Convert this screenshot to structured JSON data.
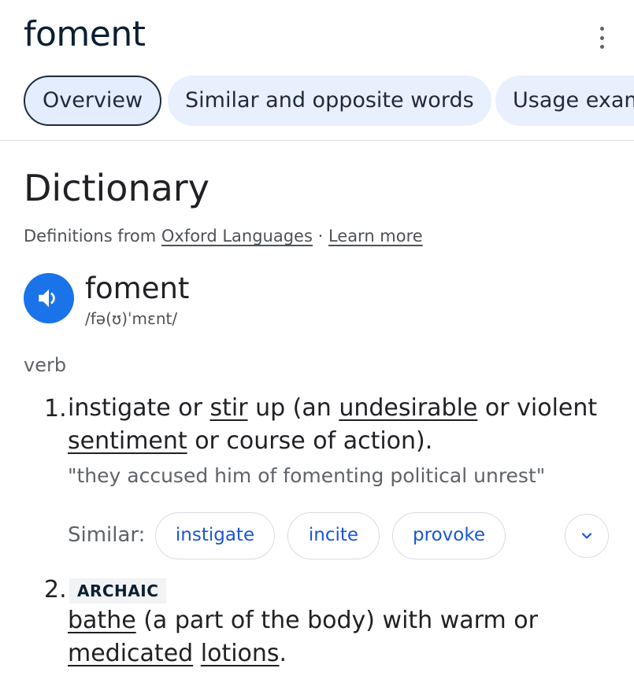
{
  "header": {
    "title": "foment",
    "menu_icon": "more-vert-icon"
  },
  "tabs": [
    {
      "label": "Overview",
      "active": true
    },
    {
      "label": "Similar and opposite words",
      "active": false
    },
    {
      "label": "Usage exam",
      "active": false
    }
  ],
  "dictionary": {
    "heading": "Dictionary",
    "source_prefix": "Definitions from ",
    "source_link": "Oxford Languages",
    "separator": " · ",
    "learn_more": "Learn more",
    "speaker_icon": "volume-icon",
    "headword": "foment",
    "pronunciation": "/fə(ʊ)ˈmɛnt/",
    "part_of_speech": "verb",
    "senses": [
      {
        "number": "1.",
        "def_parts": [
          "instigate or ",
          "stir",
          " up (an ",
          "undesirable",
          " or violent ",
          "sentiment",
          " or course of action)."
        ],
        "example": "\"they accused him of fomenting political unrest\"",
        "similar_label": "Similar:",
        "similar": [
          "instigate",
          "incite",
          "provoke"
        ],
        "expand_icon": "chevron-down-icon"
      },
      {
        "number": "2.",
        "label": "ARCHAIC",
        "def_parts": [
          "bathe",
          " (a part of the body) with warm or ",
          "medicated",
          " ",
          "lotions",
          "."
        ]
      }
    ]
  },
  "colors": {
    "accent": "#1a73e8",
    "chip_text": "#1a56d6",
    "tab_bg": "#e8f0fe"
  }
}
